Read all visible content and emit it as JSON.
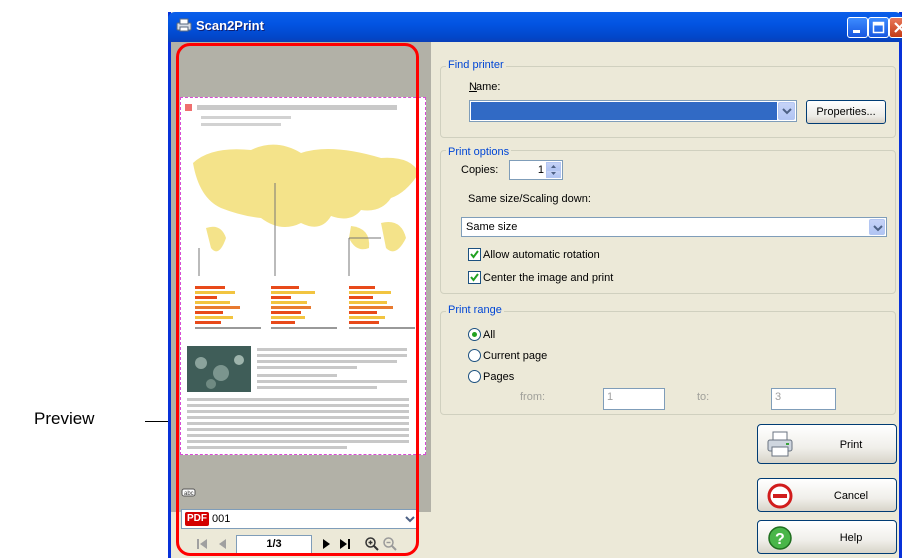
{
  "callout": {
    "label": "Preview"
  },
  "window": {
    "title": "Scan2Print"
  },
  "preview": {
    "document_name": "001",
    "document_badge": "PDF",
    "page_indicator": "1/3"
  },
  "find_printer": {
    "group_title": "Find printer",
    "name_label": "Name:",
    "properties_label": "Properties..."
  },
  "print_options": {
    "group_title": "Print options",
    "copies_label": "Copies:",
    "copies_value": "1",
    "scaling_label": "Same size/Scaling down:",
    "scaling_value": "Same size",
    "auto_rotation_label": "Allow automatic rotation",
    "auto_rotation_checked": true,
    "center_label": "Center the image and print",
    "center_checked": true
  },
  "print_range": {
    "group_title": "Print range",
    "all_label": "All",
    "current_page_label": "Current page",
    "pages_label": "Pages",
    "from_label": "from:",
    "from_value": "1",
    "to_label": "to:",
    "to_value": "3",
    "selected": "All"
  },
  "buttons": {
    "print_label": "Print",
    "cancel_label": "Cancel",
    "help_label": "Help"
  },
  "colors": {
    "titlebar": "#0254e2",
    "group_title": "#0046d5",
    "callout_outline": "#ff0000",
    "printer_selection": "#316ac5"
  }
}
